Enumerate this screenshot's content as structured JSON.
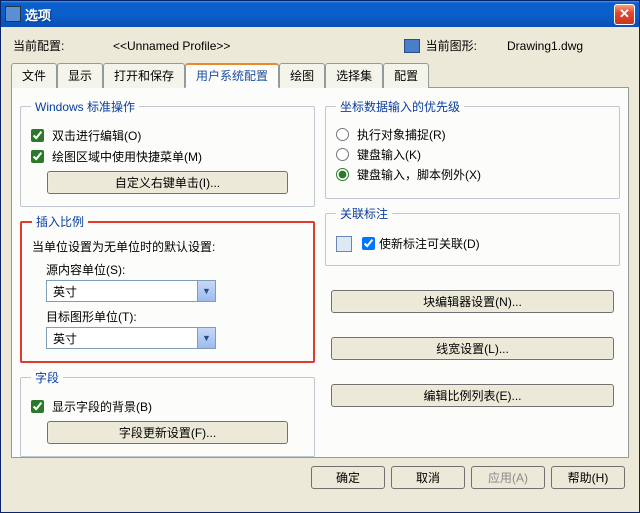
{
  "window": {
    "title": "选项",
    "close_glyph": "✕"
  },
  "header": {
    "current_config_label": "当前配置:",
    "profile_name": "<<Unnamed Profile>>",
    "current_drawing_label": "当前图形:",
    "drawing_name": "Drawing1.dwg"
  },
  "tabs": {
    "items": [
      {
        "label": "文件"
      },
      {
        "label": "显示"
      },
      {
        "label": "打开和保存"
      },
      {
        "label": "用户系统配置",
        "active": true
      },
      {
        "label": "绘图"
      },
      {
        "label": "选择集"
      },
      {
        "label": "配置"
      }
    ]
  },
  "left": {
    "win_std": {
      "legend": "Windows 标准操作",
      "dblclick_edit": "双击进行编辑(O)",
      "shortcut_menu": "绘图区域中使用快捷菜单(M)",
      "customize_btn": "自定义右键单击(I)..."
    },
    "insert_scale": {
      "legend": "插入比例",
      "note": "当单位设置为无单位时的默认设置:",
      "src_label": "源内容单位(S):",
      "src_value": "英寸",
      "tgt_label": "目标图形单位(T):",
      "tgt_value": "英寸"
    },
    "fields": {
      "legend": "字段",
      "show_bg": "显示字段的背景(B)",
      "update_btn": "字段更新设置(F)..."
    }
  },
  "right": {
    "coord_priority": {
      "legend": "坐标数据输入的优先级",
      "opt_osnap": "执行对象捕捉(R)",
      "opt_keyboard": "键盘输入(K)",
      "opt_keyboard_script": "键盘输入，脚本例外(X)"
    },
    "assoc": {
      "legend": "关联标注",
      "make_assoc": "使新标注可关联(D)"
    },
    "buttons": {
      "block_editor": "块编辑器设置(N)...",
      "lineweight": "线宽设置(L)...",
      "edit_scale_list": "编辑比例列表(E)..."
    }
  },
  "actions": {
    "ok": "确定",
    "cancel": "取消",
    "apply": "应用(A)",
    "help": "帮助(H)"
  }
}
